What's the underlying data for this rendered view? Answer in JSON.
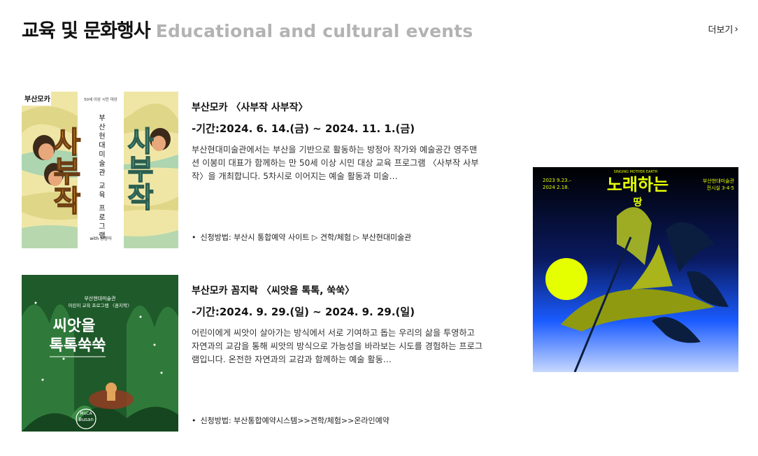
{
  "header": {
    "title_ko": "교육 및 문화행사",
    "title_en": "Educational and cultural events",
    "more_label": "더보기",
    "more_icon": "chevron-right-icon"
  },
  "events": [
    {
      "title": "부산모카 〈사부작 사부작〉",
      "period": "-기간:2024. 6. 14.(금) ~ 2024. 11. 1.(금)",
      "description": "부산현대미술관에서는 부산을 기반으로 활동하는 방정아 작가와 예술공간 영주맨션 이봉미 대표가 함께하는 만 50세 이상 시민 대상 교육 프로그램 〈사부작 사부작〉을 개최합니다. 5차시로 이어지는 예술 활동과 미술…",
      "apply": "신청방법: 부산시 통합예약 사이트 ▷ 견학/체험 ▷ 부산현대미술관",
      "poster": {
        "brand": "부산모카",
        "audience": "50세 이상 시민 대상",
        "program_vertical": "부산현대미술관 교육 프로그램",
        "big_title": "사부작",
        "credit": "with 방정아"
      }
    },
    {
      "title": "부산모카 꼼지락 〈씨앗을 톡톡, 쑥쑥〉",
      "period": "-기간:2024. 9. 29.(일) ~ 2024. 9. 29.(일)",
      "description": "어린이에게 씨앗이 살아가는 방식에서 서로 기여하고 돕는 우리의 삶을 투영하고 자연과의 교감을 통해 씨앗의 방식으로 가능성을 바라보는 시도를 경험하는 프로그램입니다. 온전한 자연과의 교감과 함께하는 예술 활동…",
      "apply": "신청방법: 부산통합예약시스템>>견학/체험>>온라인예약",
      "poster": {
        "line1": "부산현대미술관",
        "line2": "어린이 교육 프로그램 〈꼼지락〉",
        "big1": "씨앗을",
        "big2": "톡톡쑥쑥",
        "logo1": "Busan",
        "logo2": "MoCA"
      }
    }
  ],
  "side_poster": {
    "date_line1": "2023  9.23.–",
    "date_line2": "2024  2.18.",
    "en_title": "SINGING MOTHER EARTH",
    "title_main": "노래하는",
    "title_sub": "땅",
    "venue_line1": "부산현대미술관",
    "venue_line2": "전시실 3·4·5"
  },
  "colors": {
    "accent_gray": "#b3b3b3",
    "text": "#111111",
    "poster_yellow": "#e5ff00",
    "poster_blue": "#1a5bff"
  }
}
